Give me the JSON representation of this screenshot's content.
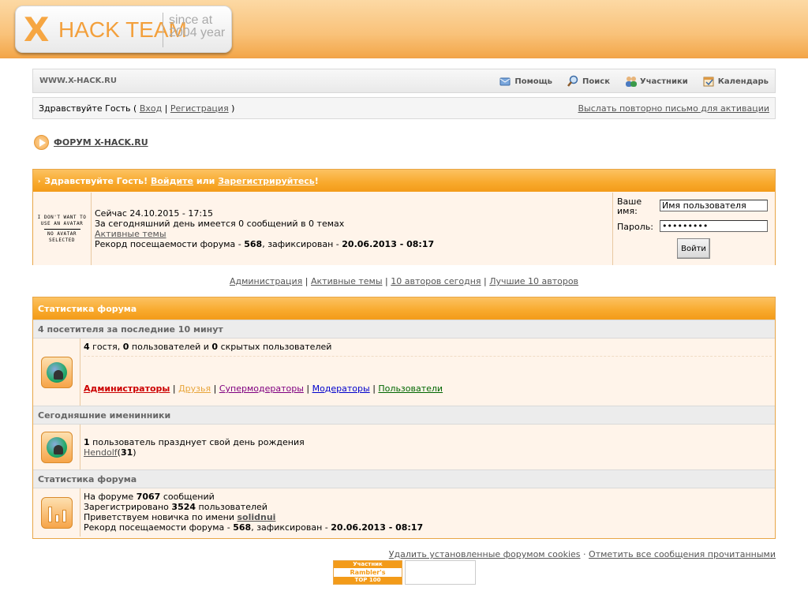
{
  "header": {
    "logo_x": "X",
    "logo_name": "HACK TEAM",
    "logo_since": "since at 2004 year"
  },
  "navbar": {
    "site_name": "WWW.X-HACK.RU",
    "links": [
      {
        "label": "Помощь",
        "icon": "help-icon"
      },
      {
        "label": "Поиск",
        "icon": "search-icon"
      },
      {
        "label": "Участники",
        "icon": "members-icon"
      },
      {
        "label": "Календарь",
        "icon": "calendar-icon"
      }
    ]
  },
  "userbar": {
    "greeting": "Здравствуйте Гость",
    "login": "Вход",
    "register": "Регистрация",
    "resend": "Выслать повторно письмо для активации"
  },
  "breadcrumb": {
    "label": "ФОРУМ X-HACK.RU"
  },
  "welcome": {
    "head_prefix": "Здравствуйте Гость!",
    "head_login": "Войдите",
    "head_or": "или",
    "head_register": "Зарегистрируйтесь",
    "avatar_line1": "I DON'T WANT TO USE AN AVATAR",
    "avatar_line2": "NO AVATAR SELECTED",
    "now": "Сейчас 24.10.2015 - 17:15",
    "today": "За сегодняшний день имеется 0 сообщений в 0 темах",
    "active_topics": "Активные темы",
    "record_prefix": "Рекорд посещаемости форума -",
    "record_count": "568",
    "record_mid": ", зафиксирован -",
    "record_date": "20.06.2013 - 08:17",
    "username_label": "Ваше имя:",
    "username_value": "Имя пользователя",
    "password_label": "Пароль:",
    "password_value": "•••••••••",
    "login_button": "Войти"
  },
  "midlinks": [
    "Администрация",
    "Активные темы",
    "10 авторов сегодня",
    "Лучшие 10 авторов"
  ],
  "stats": {
    "title": "Статистика форума",
    "visitors_head": "4 посетителя за последние 10 минут",
    "guests_count": "4",
    "guests_text": "гостя,",
    "users_count": "0",
    "users_text": "пользователей и",
    "hidden_count": "0",
    "hidden_text": "скрытых пользователей",
    "groups": [
      {
        "label": "Администраторы",
        "color": "#cc0000"
      },
      {
        "label": "Друзья",
        "color": "#e8a53b"
      },
      {
        "label": "Супермодераторы",
        "color": "#800080"
      },
      {
        "label": "Модераторы",
        "color": "#0000cc"
      },
      {
        "label": "Пользователи",
        "color": "#006600"
      }
    ],
    "birthdays_head": "Сегодняшние именинники",
    "bday_count": "1",
    "bday_text": "пользователь празднует свой день рождения",
    "bday_user": "Hendolf",
    "bday_age": "31",
    "forumstats_head": "Статистика форума",
    "posts_prefix": "На форуме",
    "posts_count": "7067",
    "posts_suffix": "сообщений",
    "reg_prefix": "Зарегистрировано",
    "reg_count": "3524",
    "reg_suffix": "пользователей",
    "newbie_prefix": "Приветствуем новичка по имени",
    "newbie_name": "solidnui",
    "record_prefix": "Рекорд посещаемости форума -",
    "record_count": "568",
    "record_mid": ", зафиксирован -",
    "record_date": "20.06.2013 - 08:17"
  },
  "footer": {
    "delete_cookies": "Удалить установленные форумом cookies",
    "mark_read": "Отметить все сообщения прочитанными",
    "rambler_1": "Участник",
    "rambler_2": "Rambler's",
    "rambler_3": "TOP 100"
  }
}
